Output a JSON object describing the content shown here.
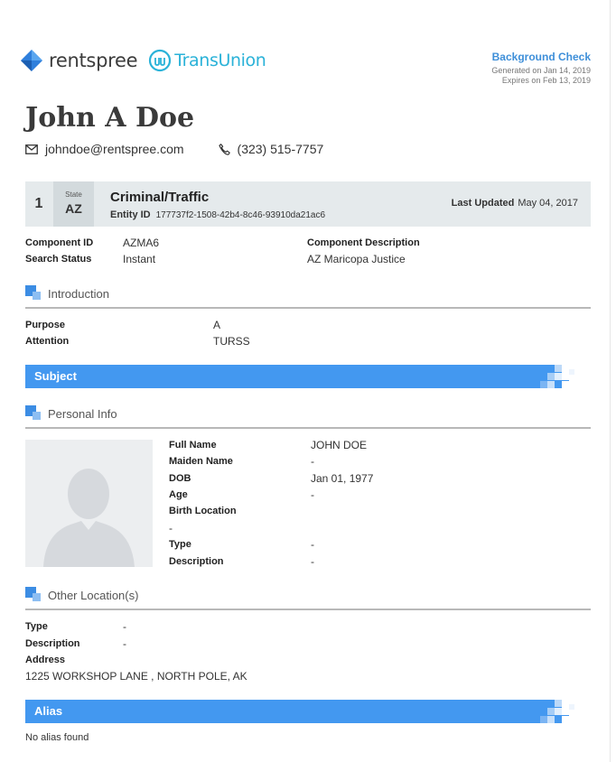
{
  "header": {
    "brand": "rentspree",
    "partner": "TransUnion",
    "report_title": "Background Check",
    "generated": "Generated on Jan 14, 2019",
    "expires": "Expires on Feb 13, 2019",
    "colors": {
      "accent": "#4398f0",
      "brand_blue": "#3e8fd9",
      "transunion": "#2ab2d8"
    }
  },
  "applicant": {
    "name": "John A Doe",
    "email": "johndoe@rentspree.com",
    "phone": "(323) 515-7757"
  },
  "record": {
    "number": "1",
    "state_label": "State",
    "state": "AZ",
    "title": "Criminal/Traffic",
    "entity_label": "Entity ID",
    "entity_id": "177737f2-1508-42b4-8c46-93910da21ac6",
    "updated_label": "Last Updated",
    "updated": "May 04, 2017"
  },
  "component": {
    "id_label": "Component ID",
    "id": "AZMA6",
    "status_label": "Search Status",
    "status": "Instant",
    "desc_label": "Component Description",
    "desc": "AZ Maricopa Justice"
  },
  "introduction": {
    "title": "Introduction",
    "purpose_label": "Purpose",
    "purpose": "A",
    "attention_label": "Attention",
    "attention": "TURSS"
  },
  "subject": {
    "title": "Subject"
  },
  "personal_info": {
    "title": "Personal Info",
    "full_name_label": "Full Name",
    "full_name": "JOHN DOE",
    "maiden_label": "Maiden Name",
    "maiden": "-",
    "dob_label": "DOB",
    "dob": "Jan 01, 1977",
    "age_label": "Age",
    "age": "-",
    "birth_location_label": "Birth Location",
    "birth_location": "-",
    "type_label": "Type",
    "type": "-",
    "description_label": "Description",
    "description": "-"
  },
  "other_locations": {
    "title": "Other Location(s)",
    "type_label": "Type",
    "type": "-",
    "description_label": "Description",
    "description": "-",
    "address_label": "Address",
    "address": "1225 WORKSHOP LANE , NORTH POLE, AK"
  },
  "alias": {
    "title": "Alias",
    "empty_text": "No alias found"
  }
}
